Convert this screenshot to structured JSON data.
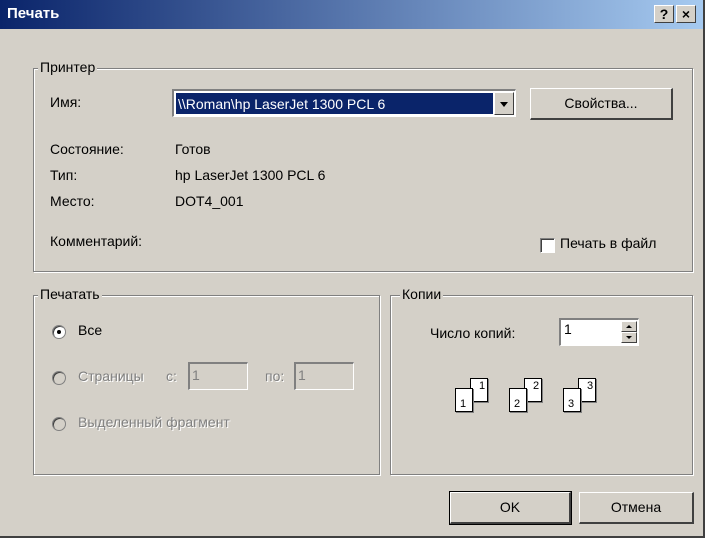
{
  "window": {
    "title": "Печать",
    "help_button": "?",
    "close_button": "×"
  },
  "printer": {
    "legend": "Принтер",
    "name_label": "Имя:",
    "name_value": "\\\\Roman\\hp LaserJet 1300 PCL 6",
    "properties_button": "Свойства...",
    "status_label": "Состояние:",
    "status_value": "Готов",
    "type_label": "Тип:",
    "type_value": "hp LaserJet 1300 PCL 6",
    "where_label": "Место:",
    "where_value": "DOT4_001",
    "comment_label": "Комментарий:",
    "print_to_file_label": "Печать в файл",
    "print_to_file_checked": false
  },
  "range": {
    "legend": "Печатать",
    "all_label": "Все",
    "pages_label": "Страницы",
    "from_label": "с:",
    "from_value": "1",
    "to_label": "по:",
    "to_value": "1",
    "selection_label": "Выделенный фрагмент",
    "selected": "all"
  },
  "copies": {
    "legend": "Копии",
    "count_label": "Число копий:",
    "count_value": "1",
    "collate_pages": [
      "1",
      "1",
      "2",
      "2",
      "3",
      "3"
    ]
  },
  "buttons": {
    "ok": "OK",
    "cancel": "Отмена"
  }
}
